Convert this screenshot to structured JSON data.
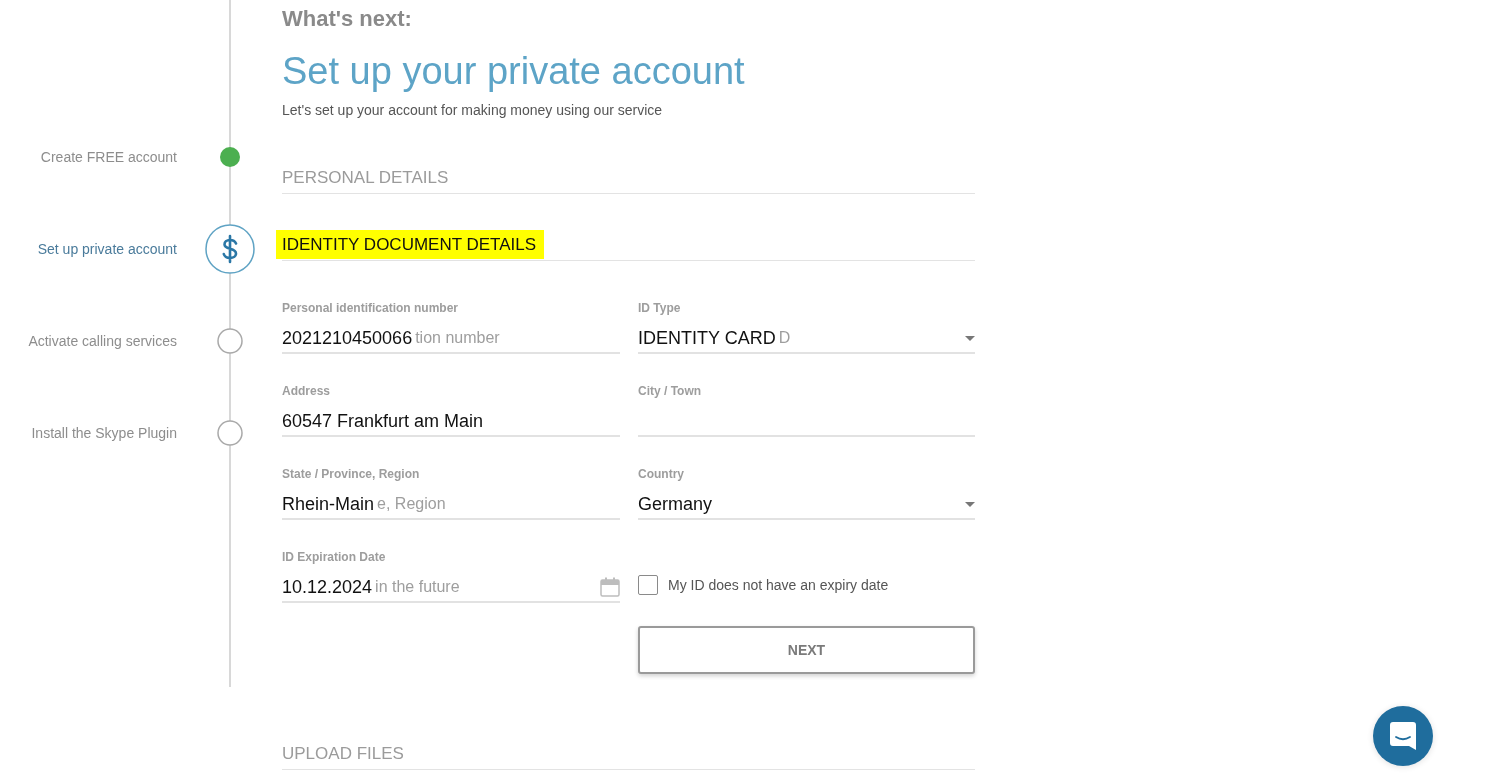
{
  "header": {
    "eyebrow": "What's next:",
    "title": "Set up your private account",
    "subtitle": "Let's set up your account for making money using our service"
  },
  "steps": [
    {
      "label": "Create FREE account",
      "completed": true,
      "selected": false
    },
    {
      "label": "Set up private account",
      "completed": false,
      "selected": true
    },
    {
      "label": "Activate calling services",
      "completed": false,
      "selected": false
    },
    {
      "label": "Install the Skype Plugin",
      "completed": false,
      "selected": false
    }
  ],
  "sections": [
    {
      "title": "PERSONAL DETAILS",
      "highlighted": false
    },
    {
      "title": "IDENTITY DOCUMENT DETAILS",
      "highlighted": true,
      "fields": [
        {
          "kind": "text",
          "label": "Personal identification number",
          "value": "2021210450066",
          "ghost_text": "tion number"
        },
        {
          "kind": "select",
          "label": "ID Type",
          "value": "IDENTITY CARD",
          "ghost_text": "D"
        },
        {
          "kind": "text",
          "label": "Address",
          "value": "60547 Frankfurt am Main"
        },
        {
          "kind": "text",
          "label": "City / Town"
        },
        {
          "kind": "text",
          "label": "State / Province, Region",
          "value": "Rhein-Main",
          "ghost_text": "e, Region"
        },
        {
          "kind": "select",
          "label": "Country",
          "value": "Germany"
        },
        {
          "kind": "date",
          "label": "ID Expiration Date",
          "value": "10.12.2024",
          "ghost_text": "in the future"
        }
      ],
      "checkbox": {
        "label": "My ID does not have an expiry date",
        "checked": false
      },
      "button": "NEXT"
    },
    {
      "title": "UPLOAD FILES",
      "highlighted": false
    }
  ]
}
